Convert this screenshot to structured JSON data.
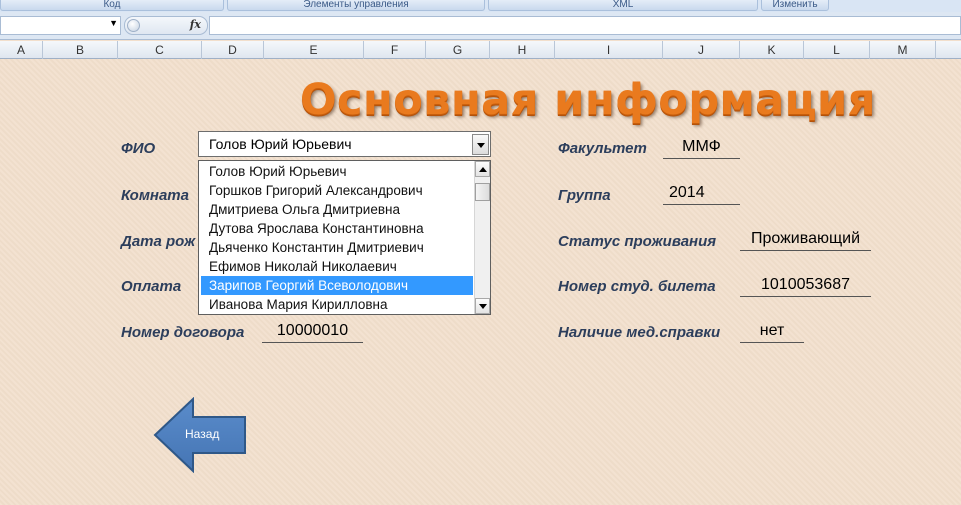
{
  "ribbon": {
    "groups": [
      "Код",
      "Элементы управления",
      "XML",
      "Изменить"
    ]
  },
  "formula_bar": {
    "name_box_value": "",
    "fx_label": "fx",
    "formula_value": ""
  },
  "columns": [
    "A",
    "B",
    "C",
    "D",
    "E",
    "F",
    "G",
    "H",
    "I",
    "J",
    "K",
    "L",
    "M"
  ],
  "form": {
    "title": "Основная информация",
    "fio_label": "ФИО",
    "fio_selected": "Голов Юрий Юрьевич",
    "room_label": "Комната",
    "birth_label": "Дата рож",
    "payment_label": "Оплата",
    "contract_label": "Номер договора",
    "contract_value": "10000010",
    "faculty_label": "Факультет",
    "faculty_value": "ММФ",
    "group_label": "Группа",
    "group_value": "2014",
    "status_label": "Статус проживания",
    "status_value": "Проживающий",
    "card_label": "Номер студ. билета",
    "card_value": "1010053687",
    "medical_label": "Наличие мед.справки",
    "medical_value": "нет"
  },
  "dropdown": {
    "items": [
      "Голов Юрий Юрьевич",
      "Горшков Григорий Александрович",
      "Дмитриева Ольга Дмитриевна",
      "Дутова Ярослава Константиновна",
      "Дьяченко Константин Дмитриевич",
      "Ефимов Николай Николаевич",
      "Зарипов Георгий Всеволодович",
      "Иванова Мария Кирилловна"
    ],
    "highlighted_index": 6
  },
  "back_button": {
    "label": "Назад"
  },
  "colors": {
    "title": "#e97a1e",
    "sheet_bg": "#f2dfcc",
    "label": "#2c3e5c",
    "selection": "#3399ff",
    "back_button": "#4f81bd"
  }
}
